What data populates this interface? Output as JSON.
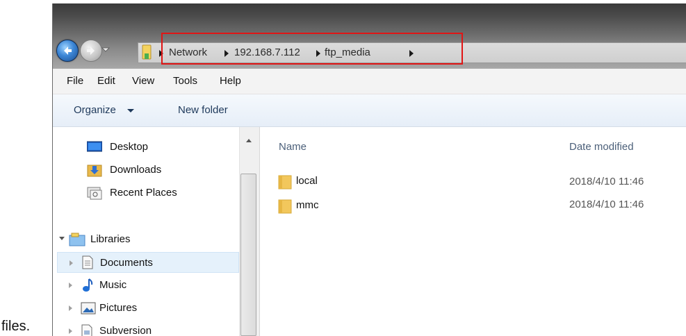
{
  "caption": "files.",
  "address_bar": {
    "segments": [
      "Network",
      "192.168.7.112",
      "ftp_media"
    ]
  },
  "menu": {
    "file": "File",
    "edit": "Edit",
    "view": "View",
    "tools": "Tools",
    "help": "Help"
  },
  "commands": {
    "organize": "Organize",
    "new_folder": "New folder"
  },
  "nav_pane": {
    "favorites": [
      {
        "label": "Desktop",
        "icon": "desktop-icon"
      },
      {
        "label": "Downloads",
        "icon": "downloads-folder-icon"
      },
      {
        "label": "Recent Places",
        "icon": "recent-places-icon"
      }
    ],
    "libraries": {
      "label": "Libraries",
      "icon": "libraries-icon",
      "items": [
        {
          "label": "Documents",
          "icon": "documents-icon",
          "selected": true
        },
        {
          "label": "Music",
          "icon": "music-icon"
        },
        {
          "label": "Pictures",
          "icon": "pictures-icon"
        },
        {
          "label": "Subversion",
          "icon": "subversion-icon"
        }
      ]
    }
  },
  "file_list": {
    "columns": {
      "name": "Name",
      "date_modified": "Date modified"
    },
    "rows": [
      {
        "name": "local",
        "date": "2018/4/10 11:46",
        "icon": "folder-icon"
      },
      {
        "name": "mmc",
        "date": "2018/4/10 11:46",
        "icon": "folder-icon"
      }
    ]
  },
  "colors": {
    "highlight_box": "#e11515",
    "selected_bg": "#e5f1fb",
    "folder": "#f2c75c"
  }
}
